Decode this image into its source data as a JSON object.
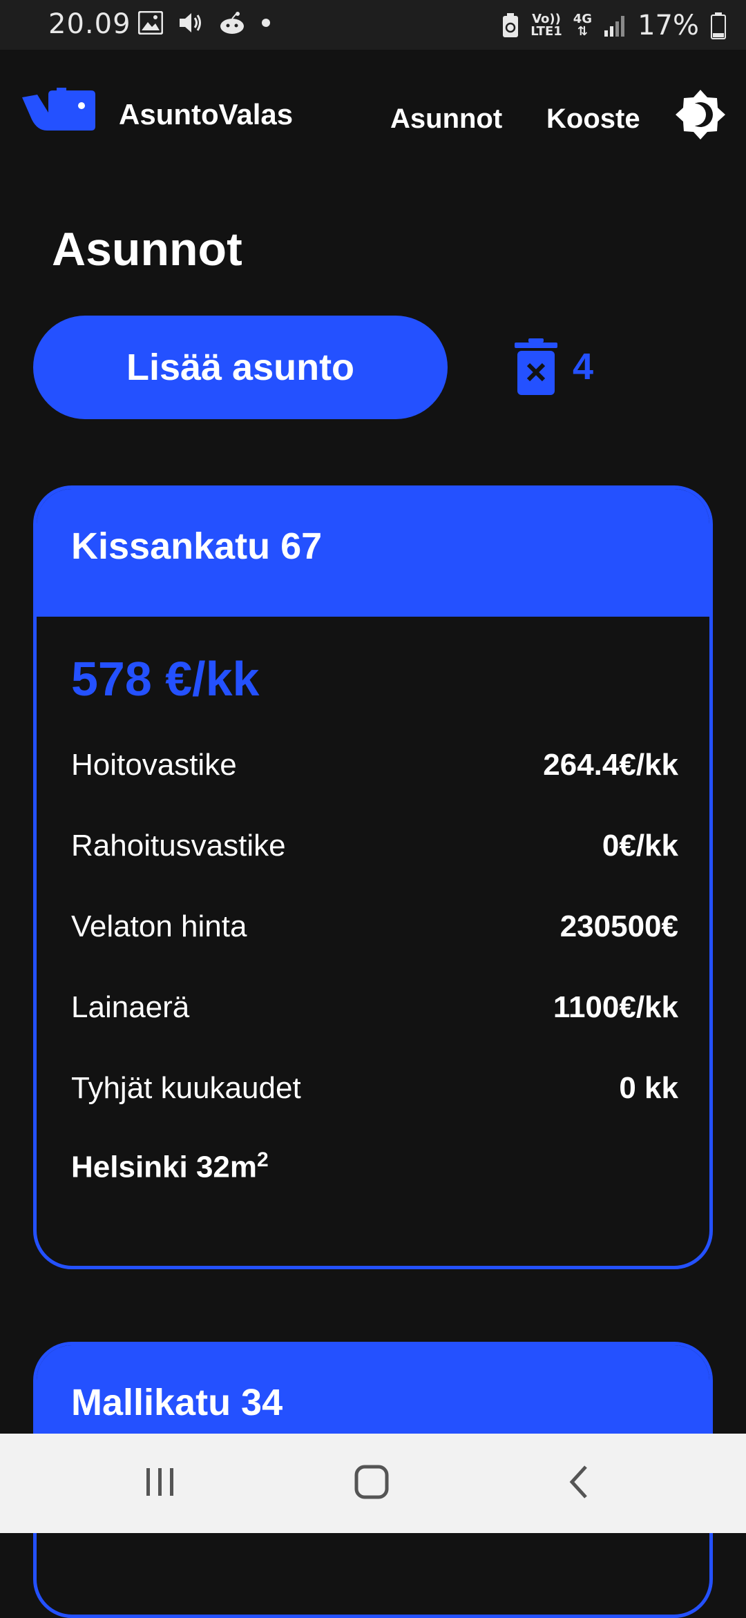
{
  "status_bar": {
    "time": "20.09",
    "icons": [
      "image-icon",
      "volume-icon",
      "reddit-icon",
      "dot-icon"
    ],
    "network_top": "Vo))",
    "network_bottom": "LTE1",
    "network_gen": "4G",
    "battery": "17%"
  },
  "header": {
    "brand": "AsuntoValas",
    "nav": [
      "Asunnot",
      "Kooste"
    ],
    "accent": "#2451ff"
  },
  "page": {
    "title": "Asunnot",
    "add_button": "Lisää asunto",
    "trash_count": "4"
  },
  "cards": [
    {
      "title": "Kissankatu 67",
      "price": "578 €/kk",
      "rows": [
        {
          "label": "Hoitovastike",
          "value": "264.4€/kk"
        },
        {
          "label": "Rahoitusvastike",
          "value": "0€/kk"
        },
        {
          "label": "Velaton hinta",
          "value": "230500€"
        },
        {
          "label": "Lainaerä",
          "value": "1100€/kk"
        },
        {
          "label": "Tyhjät kuukaudet",
          "value": "0 kk"
        }
      ],
      "location": "Helsinki 32m",
      "location_sup": "2"
    },
    {
      "title": "Mallikatu 34"
    }
  ],
  "nav_bar": {
    "icons": [
      "recent-apps-icon",
      "home-icon",
      "back-icon"
    ]
  }
}
